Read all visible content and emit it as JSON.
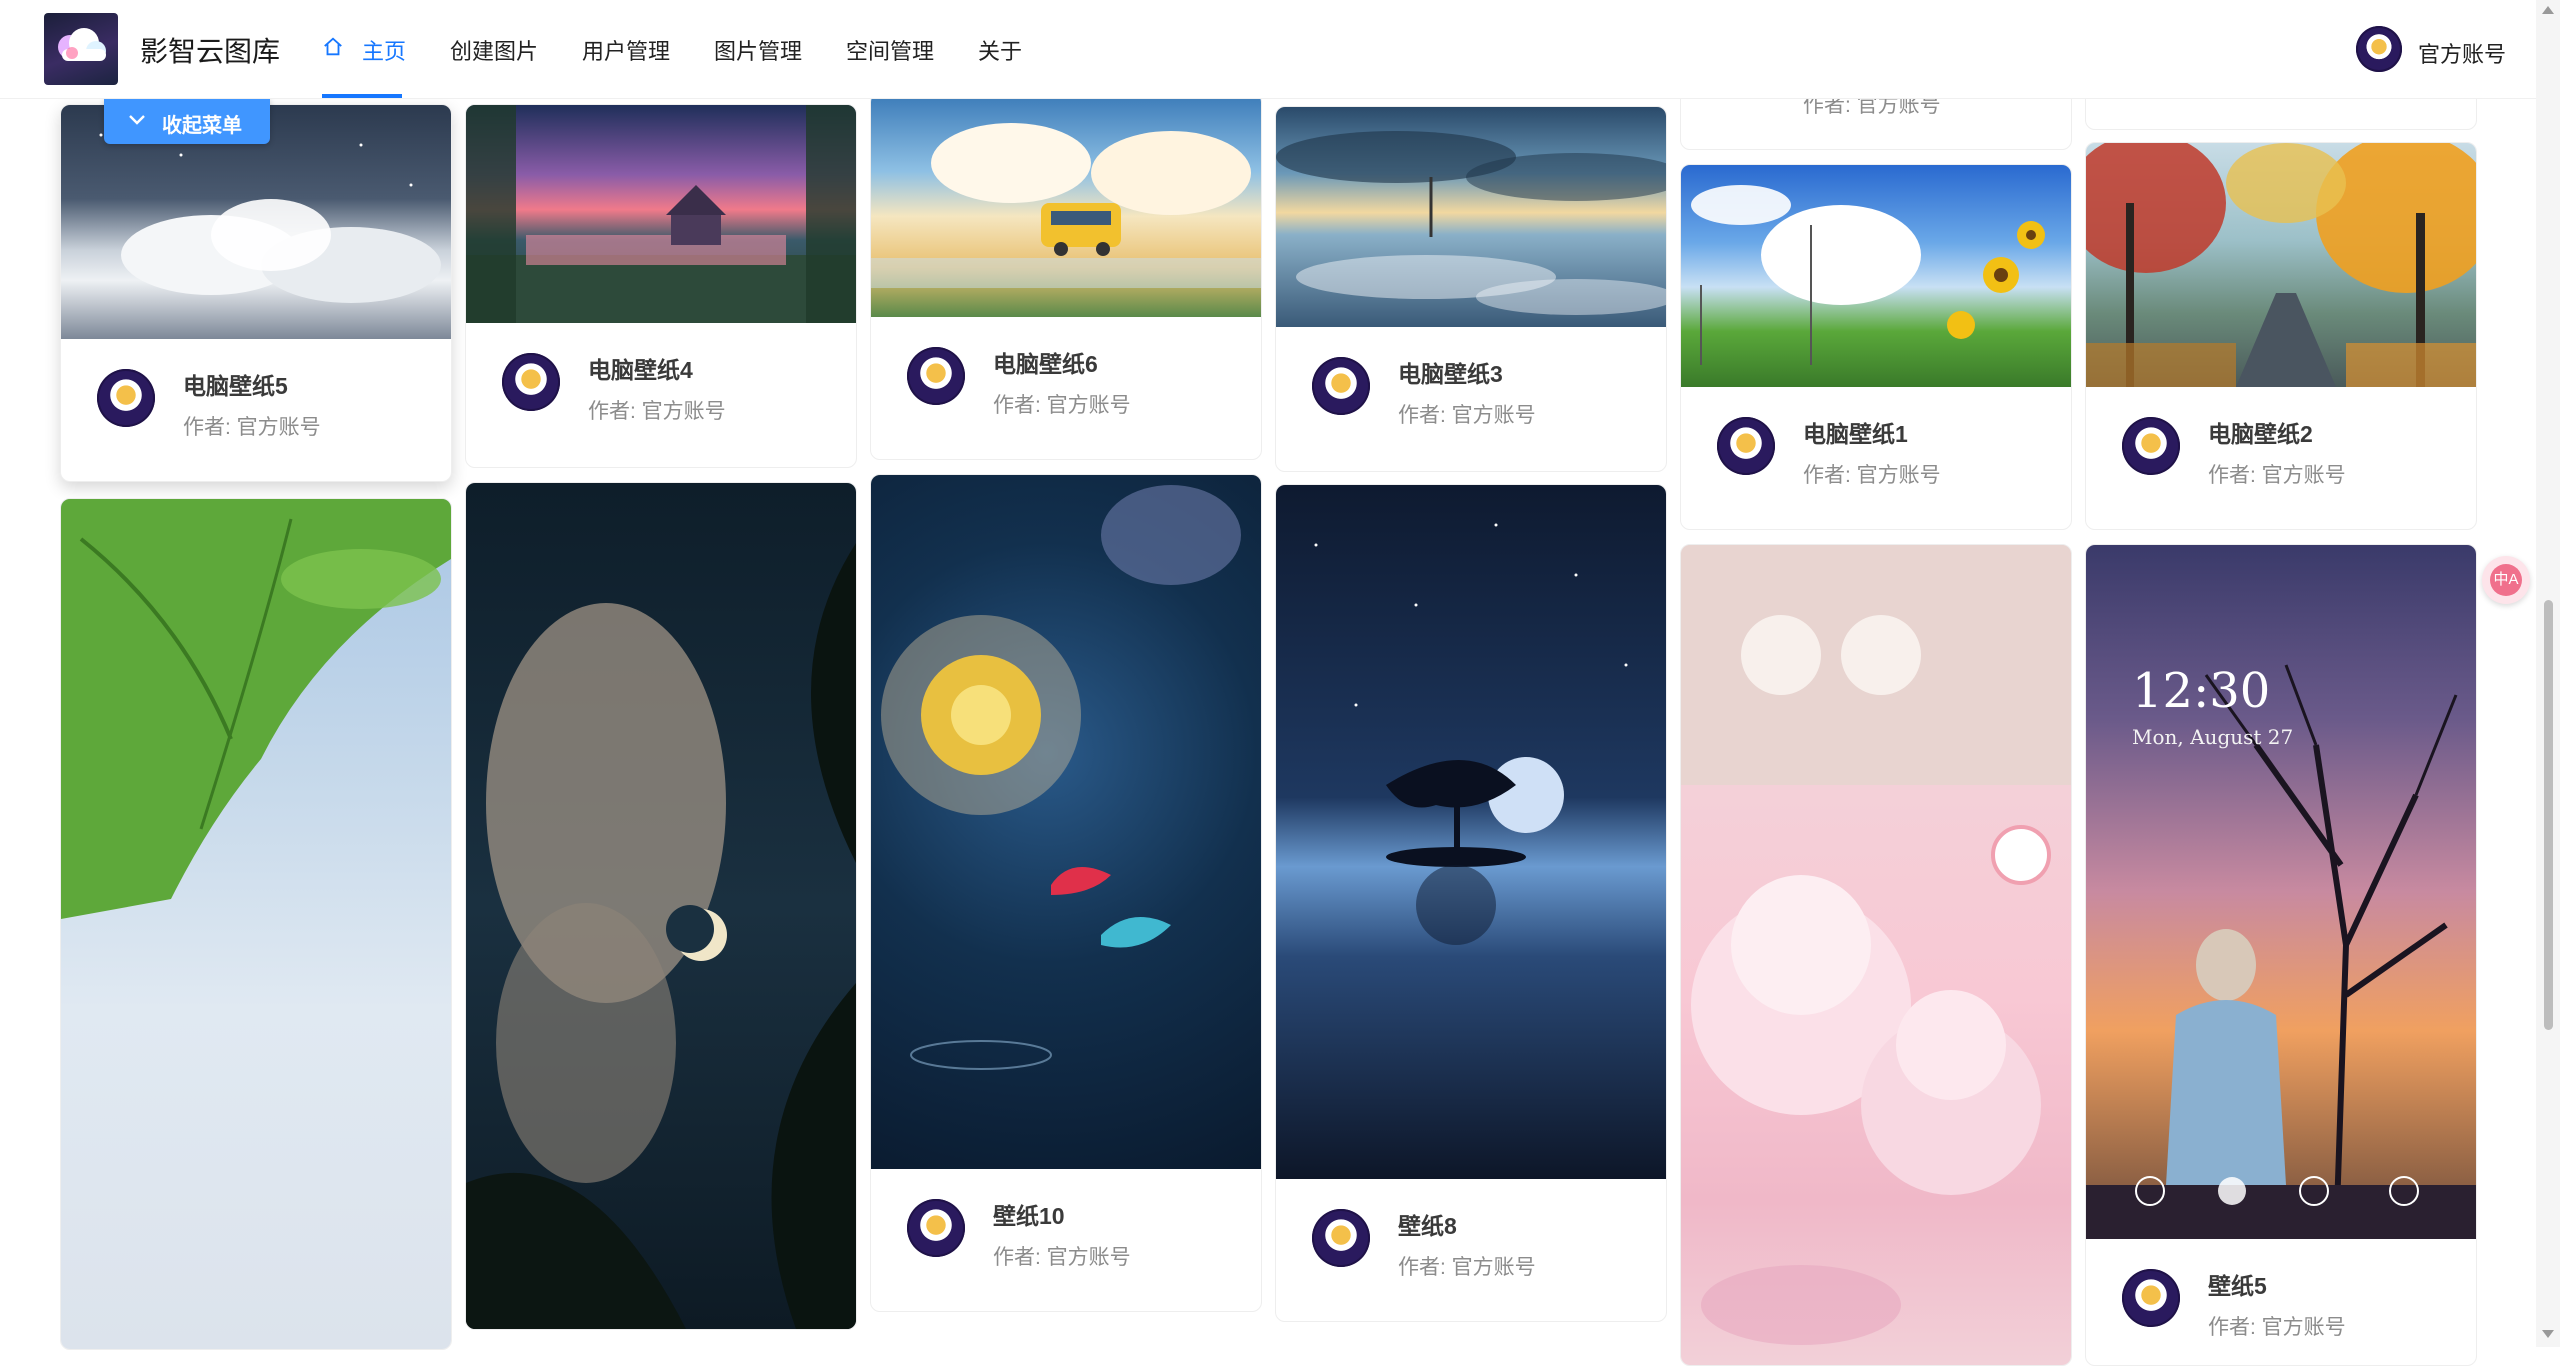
{
  "app": {
    "title": "影智云图库"
  },
  "nav": {
    "items": [
      {
        "label": "主页",
        "active": true
      },
      {
        "label": "创建图片"
      },
      {
        "label": "用户管理"
      },
      {
        "label": "图片管理"
      },
      {
        "label": "空间管理"
      },
      {
        "label": "关于"
      }
    ]
  },
  "account": {
    "name": "官方账号"
  },
  "collapse_menu": {
    "label": "收起菜单"
  },
  "translate": {
    "label": "中A"
  },
  "cards": [
    {
      "title": "电脑壁纸5",
      "author": "作者: 官方账号"
    },
    {
      "title": "电脑壁纸4",
      "author": "作者: 官方账号"
    },
    {
      "title": "电脑壁纸6",
      "author": "作者: 官方账号"
    },
    {
      "title": "电脑壁纸3",
      "author": "作者: 官方账号"
    },
    {
      "title": "电脑壁纸1",
      "author": "作者: 官方账号"
    },
    {
      "title": "电脑壁纸2",
      "author": "作者: 官方账号"
    },
    {
      "title": "壁纸10",
      "author": "作者: 官方账号"
    },
    {
      "title": "壁纸8",
      "author": "作者: 官方账号"
    },
    {
      "title": "壁纸5",
      "author": "作者: 官方账号"
    }
  ],
  "partial_card": {
    "author": "作者: 官方账号"
  },
  "lockscreen": {
    "time": "12:30",
    "date": "Mon, August 27"
  },
  "colors": {
    "accent": "#1677ff",
    "button": "#4096ff"
  }
}
